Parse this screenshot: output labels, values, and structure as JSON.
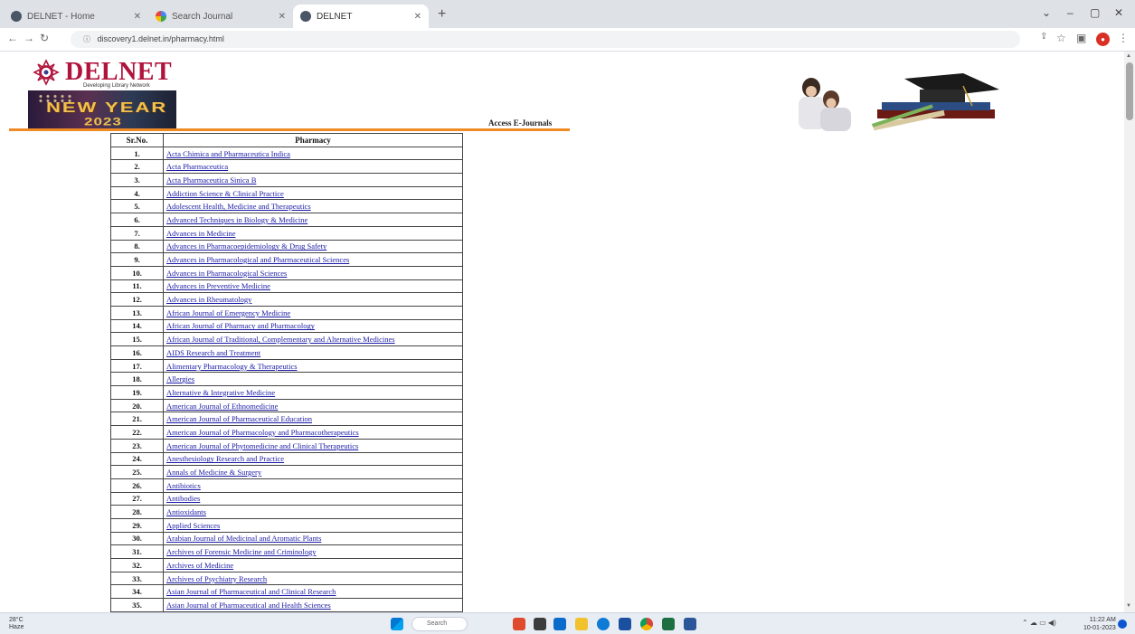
{
  "browser": {
    "tabs": [
      {
        "title": "DELNET - Home",
        "active": false,
        "favicon": "globe-icon"
      },
      {
        "title": "Search Journal",
        "active": false,
        "favicon": "google-icon"
      },
      {
        "title": "DELNET",
        "active": true,
        "favicon": "globe-icon"
      }
    ],
    "new_tab": "+",
    "window_controls": [
      "⌄",
      "–",
      "▢",
      "✕"
    ],
    "url": "discovery1.delnet.in/pharmacy.html"
  },
  "site": {
    "logo_text": "DELNET",
    "logo_subtitle": "Developing Library Network",
    "banner_line1": "NEW YEAR",
    "banner_line2": "2023",
    "access_link": "Access E-Journals"
  },
  "table": {
    "col_sno": "Sr.No.",
    "col_name": "Pharmacy",
    "rows": [
      {
        "sn": "1.",
        "name": "Acta Chimica and Pharmaceutica Indica"
      },
      {
        "sn": "2.",
        "name": "Acta Pharmaceutica"
      },
      {
        "sn": "3.",
        "name": "Acta Pharmaceutica Sinica B"
      },
      {
        "sn": "4.",
        "name": "Addiction Science & Clinical Practice"
      },
      {
        "sn": "5.",
        "name": "Adolescent Health, Medicine and Therapeutics"
      },
      {
        "sn": "6.",
        "name": "Advanced Techniques in Biology & Medicine"
      },
      {
        "sn": "7.",
        "name": "Advances in Medicine"
      },
      {
        "sn": "8.",
        "name": "Advances in Pharmacoepidemiology & Drug Safety"
      },
      {
        "sn": "9.",
        "name": "Advances in Pharmacological and Pharmaceutical Sciences"
      },
      {
        "sn": "10.",
        "name": "Advances in Pharmacological Sciences"
      },
      {
        "sn": "11.",
        "name": "Advances in Preventive Medicine"
      },
      {
        "sn": "12.",
        "name": "Advances in Rheumatology"
      },
      {
        "sn": "13.",
        "name": "African Journal of Emergency Medicine"
      },
      {
        "sn": "14.",
        "name": "African Journal of Pharmacy and Pharmacology"
      },
      {
        "sn": "15.",
        "name": "African Journal of Traditional, Complementary and Alternative Medicines"
      },
      {
        "sn": "16.",
        "name": "AIDS Research and Treatment"
      },
      {
        "sn": "17.",
        "name": "Alimentary Pharmacology & Therapeutics"
      },
      {
        "sn": "18.",
        "name": "Allergies"
      },
      {
        "sn": "19.",
        "name": "Alternative & Integrative Medicine"
      },
      {
        "sn": "20.",
        "name": "American Journal of Ethnomedicine"
      },
      {
        "sn": "21.",
        "name": "American Journal of Pharmaceutical Education"
      },
      {
        "sn": "22.",
        "name": "American Journal of Pharmacology and Pharmacotherapeutics"
      },
      {
        "sn": "23.",
        "name": "American Journal of Phytomedicine and Clinical Therapeutics"
      },
      {
        "sn": "24.",
        "name": "Anesthesiology Research and Practice"
      },
      {
        "sn": "25.",
        "name": "Annals of Medicine & Surgery"
      },
      {
        "sn": "26.",
        "name": "Antibiotics"
      },
      {
        "sn": "27.",
        "name": "Antibodies"
      },
      {
        "sn": "28.",
        "name": "Antioxidants"
      },
      {
        "sn": "29.",
        "name": "Applied Sciences"
      },
      {
        "sn": "30.",
        "name": "Arabian Journal of Medicinal and Aromatic Plants"
      },
      {
        "sn": "31.",
        "name": "Archives of Forensic Medicine and Criminology"
      },
      {
        "sn": "32.",
        "name": "Archives of Medicine"
      },
      {
        "sn": "33.",
        "name": "Archives of Psychiatry Research"
      },
      {
        "sn": "34.",
        "name": "Asian Journal of Pharmaceutical and Clinical Research"
      },
      {
        "sn": "35.",
        "name": "Asian Journal of Pharmaceutical and Health Sciences"
      }
    ]
  },
  "taskbar": {
    "weather_temp": "28°C",
    "weather_desc": "Haze",
    "search_placeholder": "Search",
    "time": "11:22 AM",
    "date": "10-01-2023"
  },
  "colors": {
    "logo": "#b0143c",
    "rule": "#f08a24",
    "link": "#1a1aa6"
  }
}
